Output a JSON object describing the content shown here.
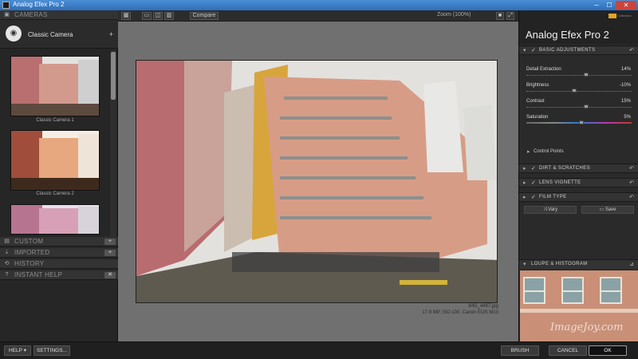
{
  "window": {
    "title": "Analog Efex Pro 2",
    "min_glyph": "─",
    "max_glyph": "☐",
    "close_glyph": "✕"
  },
  "left_panel": {
    "sections": [
      {
        "label": "CAMERAS",
        "icon": "camera-icon"
      },
      {
        "label": "CUSTOM",
        "icon": "custom-icon",
        "action": "+"
      },
      {
        "label": "IMPORTED",
        "icon": "imported-icon",
        "action": "+"
      },
      {
        "label": "HISTORY",
        "icon": "history-icon"
      },
      {
        "label": "INSTANT HELP",
        "icon": "help-icon",
        "action": "✕"
      }
    ],
    "preset_group": {
      "name": "Classic Camera",
      "add": "+"
    },
    "presets": [
      {
        "label": "Classic Camera 1"
      },
      {
        "label": "Classic Camera 2"
      },
      {
        "label": ""
      }
    ]
  },
  "toolbar": {
    "compare_label": "Compare",
    "zoom_label": "Zoom (100%)"
  },
  "image": {
    "filename": "IMG_4497.jpg",
    "info": "17.9 MP, ISO 100, Canon EOS M10"
  },
  "right_panel": {
    "app_title": "Analog Efex Pro",
    "app_version": "2",
    "collection": "Collection",
    "basic": {
      "label": "BASIC ADJUSTMENTS",
      "sliders": [
        {
          "name": "Detail Extraction",
          "value": "14%",
          "level": 0.57
        },
        {
          "name": "Brightness",
          "value": "-10%",
          "level": 0.45
        },
        {
          "name": "Contrast",
          "value": "15%",
          "level": 0.57
        },
        {
          "name": "Saturation",
          "value": "5%",
          "level": 0.52
        }
      ]
    },
    "control_points_label": "Control Points",
    "filters": [
      {
        "label": "DIRT & SCRATCHES"
      },
      {
        "label": "LENS VIGNETTE"
      },
      {
        "label": "FILM TYPE"
      }
    ],
    "vary_label": "Vary",
    "save_label": "Save",
    "loupe_label": "LOUPE & HISTOGRAM",
    "watermark": "ImageJoy.com"
  },
  "bottom": {
    "help_label": "HELP ▾",
    "settings_label": "SETTINGS...",
    "brush_label": "BRUSH",
    "cancel_label": "CANCEL",
    "ok_label": "OK"
  }
}
